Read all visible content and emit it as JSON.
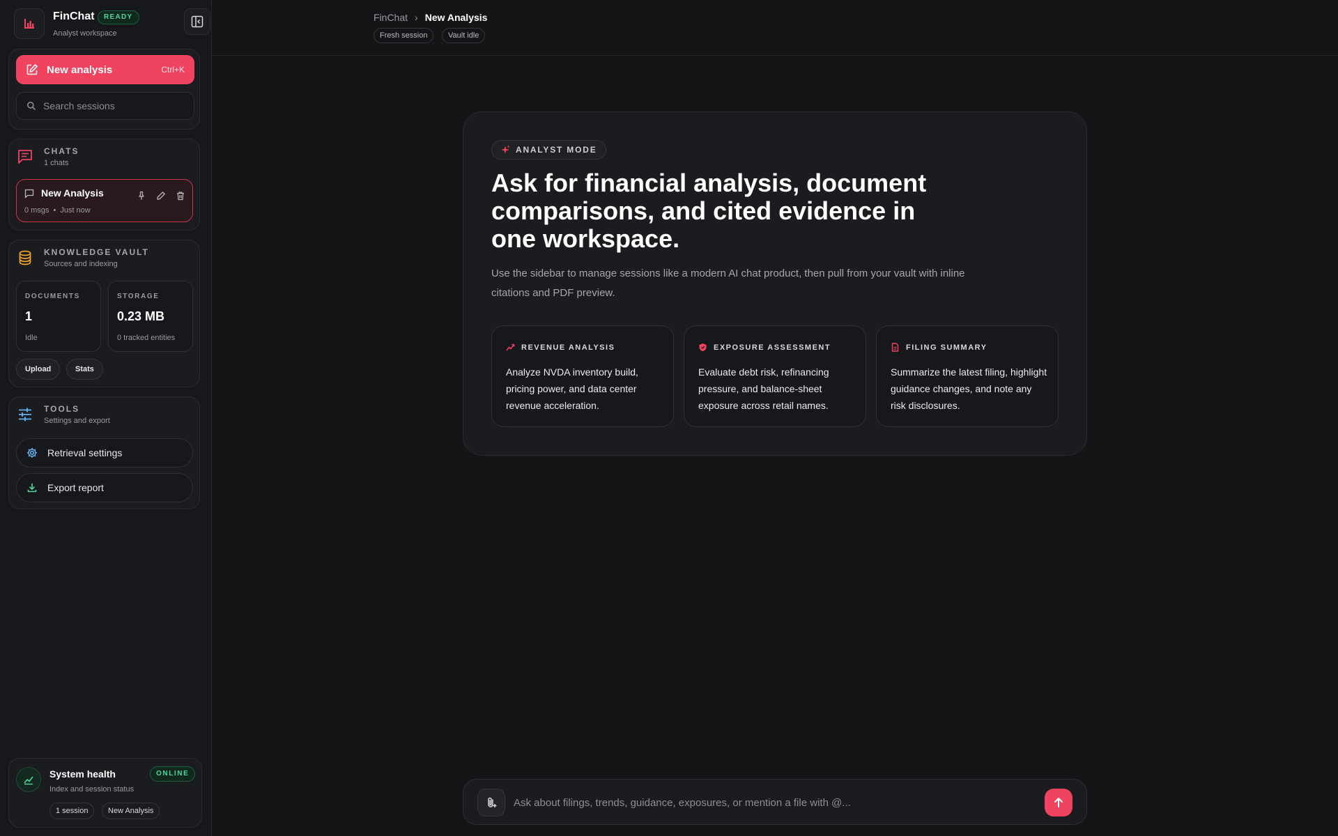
{
  "brand": {
    "name": "FinChat",
    "status": "READY",
    "subtitle": "Analyst workspace"
  },
  "actions": {
    "new_label": "New analysis",
    "new_shortcut": "Ctrl+K",
    "search_placeholder": "Search sessions"
  },
  "chats": {
    "title": "CHATS",
    "subtitle": "1 chats",
    "items": [
      {
        "title": "New Analysis",
        "msgs": "0 msgs",
        "time": "Just now"
      }
    ]
  },
  "vault": {
    "title": "KNOWLEDGE VAULT",
    "subtitle": "Sources and indexing",
    "documents": {
      "label": "DOCUMENTS",
      "value": "1",
      "sub": "Idle"
    },
    "storage": {
      "label": "STORAGE",
      "value": "0.23 MB",
      "sub": "0 tracked entities"
    },
    "upload_label": "Upload",
    "stats_label": "Stats"
  },
  "tools": {
    "title": "TOOLS",
    "subtitle": "Settings and export",
    "retrieval_label": "Retrieval settings",
    "export_label": "Export report"
  },
  "health": {
    "title": "System health",
    "status": "ONLINE",
    "subtitle": "Index and session status",
    "chips": [
      "1 session",
      "New Analysis"
    ]
  },
  "topbar": {
    "crumbs": [
      "FinChat",
      "New Analysis"
    ],
    "chips": [
      "Fresh session",
      "Vault idle"
    ]
  },
  "hero": {
    "mode": "ANALYST MODE",
    "headline": "Ask for financial analysis, document comparisons, and cited evidence in one workspace.",
    "description": "Use the sidebar to manage sessions like a modern AI chat product, then pull from your vault with inline citations and PDF preview.",
    "cards": [
      {
        "title": "REVENUE ANALYSIS",
        "icon": "trend-chart-icon",
        "body": "Analyze NVDA inventory build, pricing power, and data center revenue acceleration."
      },
      {
        "title": "EXPOSURE ASSESSMENT",
        "icon": "shield-icon",
        "body": "Evaluate debt risk, refinancing pressure, and balance-sheet exposure across retail names."
      },
      {
        "title": "FILING SUMMARY",
        "icon": "document-icon",
        "body": "Summarize the latest filing, highlight guidance changes, and note any risk disclosures."
      }
    ]
  },
  "composer": {
    "placeholder": "Ask about filings, trends, guidance, exposures, or mention a file with @..."
  },
  "colors": {
    "accent": "#f0435f",
    "success": "#4fd69a",
    "background": "#141517",
    "panel": "#1b1c1f",
    "vault_icon": "#f5a524",
    "tools_icon": "#5fb3f0"
  }
}
